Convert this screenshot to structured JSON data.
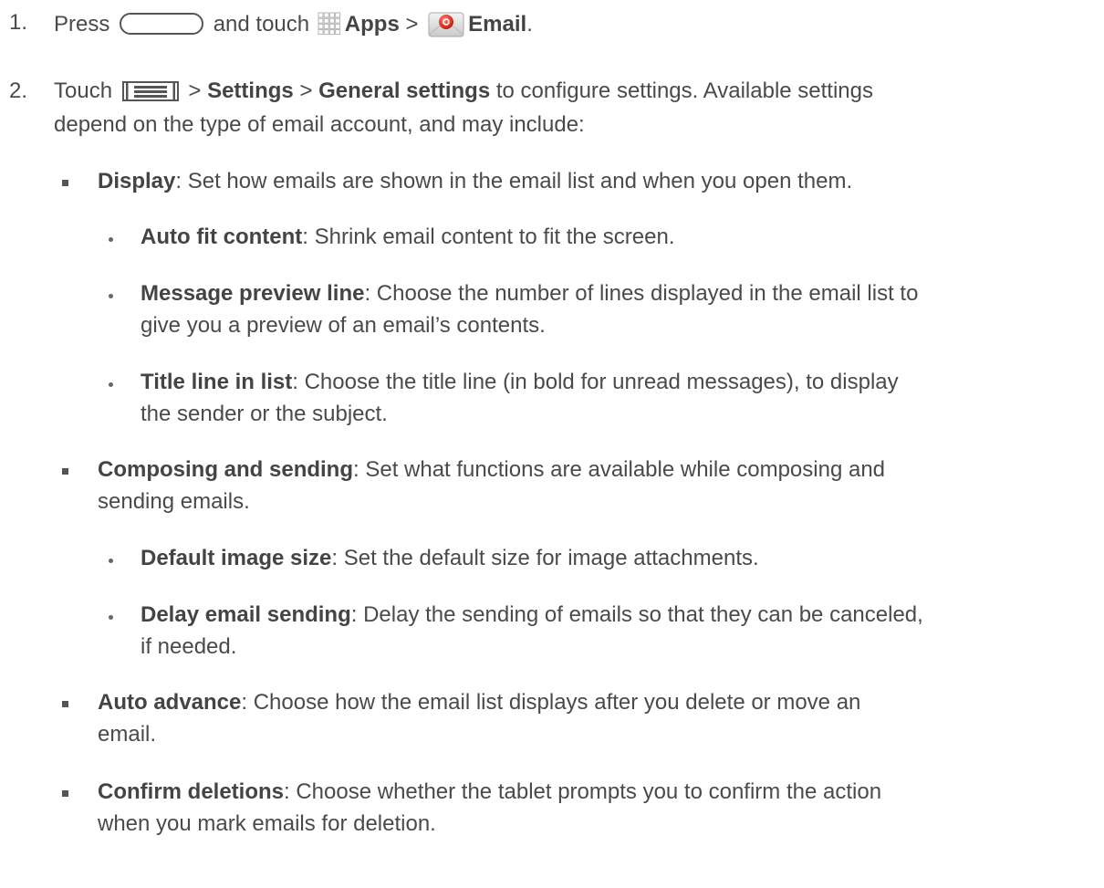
{
  "step1": {
    "number": "1.",
    "press": "Press",
    "and_touch": "and touch",
    "apps": "Apps",
    "gt": ">",
    "email": "Email",
    "period": "."
  },
  "step2": {
    "number": "2.",
    "touch": "Touch",
    "gt1": ">",
    "settings": "Settings",
    "gt2": ">",
    "general_settings": "General settings",
    "rest_line1": "to configure settings. Available settings",
    "line2": "depend on the type of email account, and may include:"
  },
  "items": {
    "display": {
      "term": "Display",
      "desc": ": Set how emails are shown in the email list and when you open them."
    },
    "auto_fit": {
      "term": "Auto fit content",
      "desc": ": Shrink email content to fit the screen."
    },
    "message_preview": {
      "term": "Message preview line",
      "desc_line1": ": Choose the number of lines displayed in the email list to",
      "desc_line2": "give you a preview of an email’s contents."
    },
    "title_line": {
      "term": "Title line in list",
      "desc_line1": ": Choose the title line (in bold for unread messages), to display",
      "desc_line2": "the sender or the subject."
    },
    "composing": {
      "term": "Composing and sending",
      "desc_line1": ": Set what functions are available while composing and",
      "desc_line2": "sending emails."
    },
    "default_image": {
      "term": "Default image size",
      "desc": ": Set the default size for image attachments."
    },
    "delay_email": {
      "term": "Delay email sending",
      "desc_line1": ": Delay the sending of emails so that they can be canceled,",
      "desc_line2": "if needed."
    },
    "auto_advance": {
      "term": "Auto advance",
      "desc_line1": ": Choose how the email list displays after you delete or move an",
      "desc_line2": "email."
    },
    "confirm_deletions": {
      "term": "Confirm deletions",
      "desc_line1": ": Choose whether the tablet prompts you to confirm the action",
      "desc_line2": "when you mark emails for deletion."
    }
  },
  "colors": {
    "text": "#4a4a4a",
    "email_icon_red": "#d9312b",
    "apps_icon_grid": "#b5b5b5"
  },
  "icons": {
    "home_key": "home-key-icon",
    "apps": "apps-grid-icon",
    "email": "email-app-icon",
    "menu": "menu-key-icon"
  }
}
